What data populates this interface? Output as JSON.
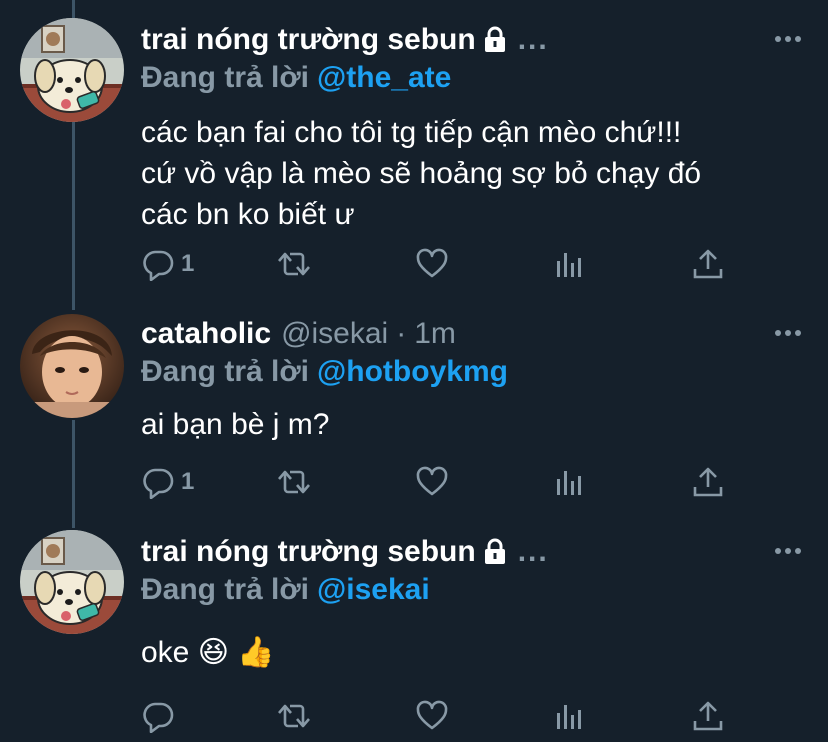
{
  "colors": {
    "background": "#15202b",
    "text": "#ffffff",
    "muted": "#8899a6",
    "link": "#1da1f2",
    "thread_line": "#3d5466"
  },
  "tweets": [
    {
      "name": "trai nóng trường sebun",
      "locked": true,
      "header_ellipsis": "...",
      "reply_prefix": "Đang trả lời",
      "reply_to": "@the_ate",
      "text": "các bạn fai cho tôi tg tiếp cận mèo chứ!!!\ncứ vồ vập là mèo sẽ hoảng sợ bỏ chạy đó\ncác bn ko biết ư",
      "reply_count": "1",
      "avatar": "dog-cartoon-avatar"
    },
    {
      "name": "cataholic",
      "handle": "@isekai",
      "dot": "·",
      "time": "1m",
      "reply_prefix": "Đang trả lời",
      "reply_to": "@hotboykmg",
      "text": "ai bạn bè j m?",
      "reply_count": "1",
      "avatar": "person-photo-avatar"
    },
    {
      "name": "trai nóng trường sebun",
      "locked": true,
      "header_ellipsis": "...",
      "reply_prefix": "Đang trả lời",
      "reply_to": "@isekai",
      "text": "oke 😆 👍",
      "reply_count": "",
      "avatar": "dog-cartoon-avatar"
    }
  ],
  "icons": {
    "reply": "reply-icon",
    "retweet": "retweet-icon",
    "like": "like-icon",
    "analytics": "analytics-icon",
    "share": "share-icon",
    "more": "more-icon",
    "lock": "lock-icon"
  }
}
